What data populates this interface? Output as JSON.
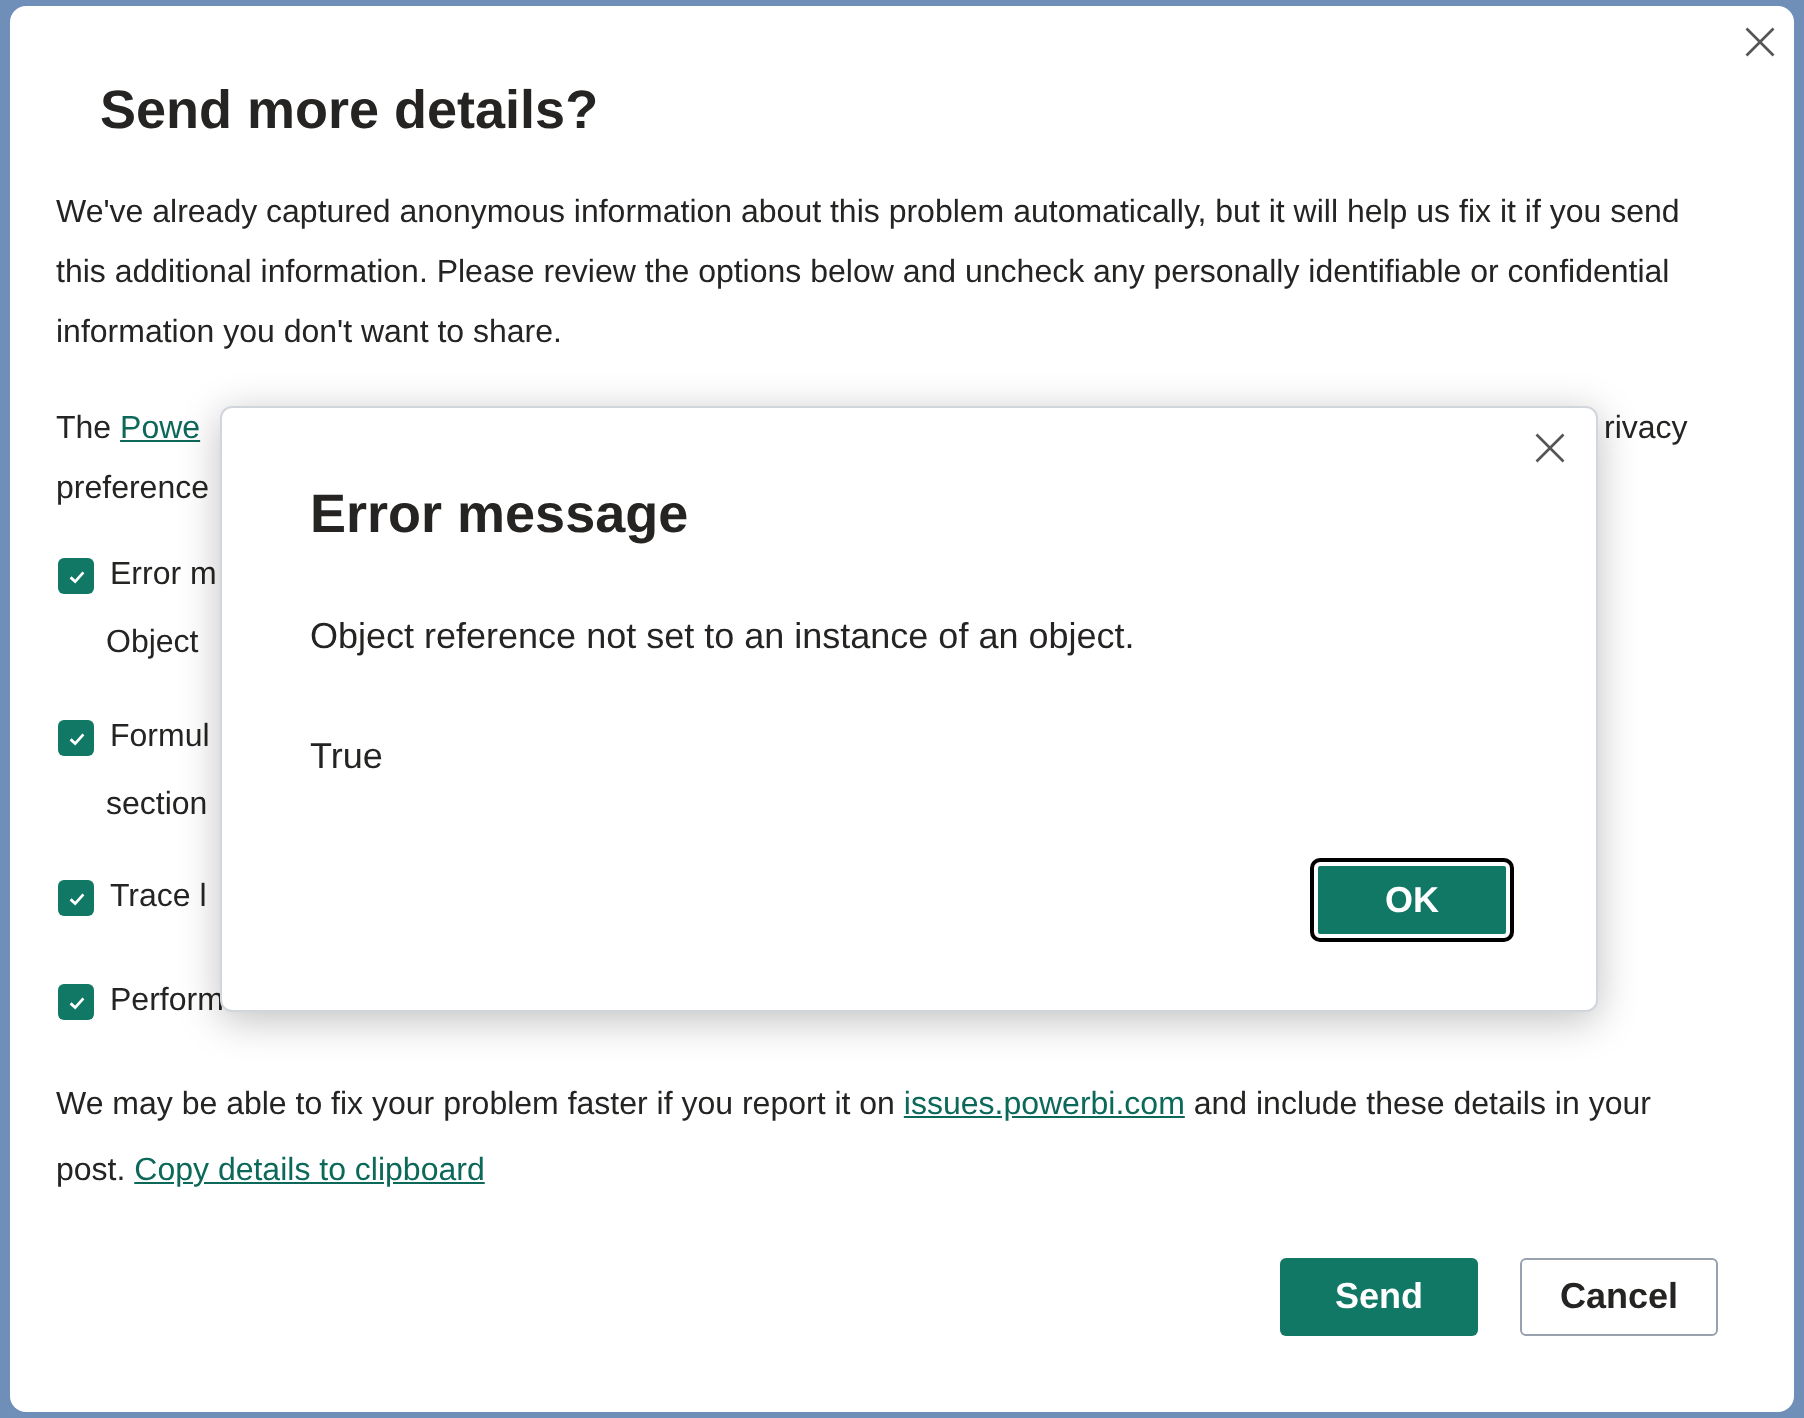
{
  "dialog": {
    "title": "Send more details?",
    "intro": "We've already captured anonymous information about this problem automatically, but it will help us fix it if you send this additional information. Please review the options below and uncheck any personally identifiable or confidential information you don't want to share.",
    "privacy": {
      "lead": "The",
      "link": "Powe",
      "line_2": "preference",
      "right_fragment": "rivacy"
    },
    "options": [
      {
        "label": "Error m",
        "detail": "Object",
        "checked": true
      },
      {
        "label": "Formul",
        "detail": "section",
        "checked": true
      },
      {
        "label": "Trace l",
        "checked": true
      },
      {
        "label": "Perform",
        "checked": true
      }
    ],
    "footer": {
      "text": "We may be able to fix your problem faster if you report it on",
      "link": "issues.powerbi.com",
      "text_2": "and include these details in your post.",
      "copy_link": "Copy details to clipboard"
    },
    "buttons": [
      {
        "label": "Send",
        "kind": "primary"
      },
      {
        "label": "Cancel",
        "kind": "secondary"
      }
    ]
  },
  "error_dialog": {
    "title": "Error message",
    "message": "Object reference not set to an instance of an object.",
    "detail": "True",
    "button": "OK"
  }
}
